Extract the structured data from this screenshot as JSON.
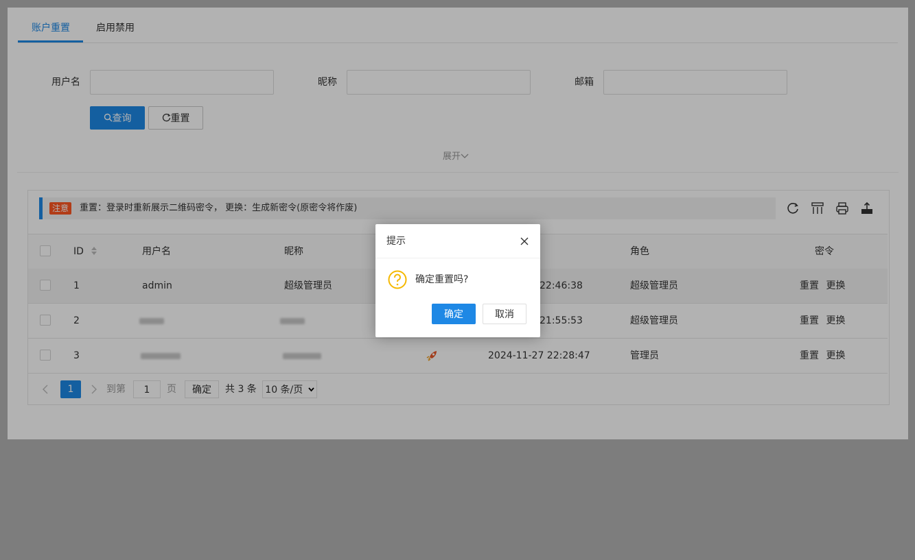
{
  "tabs": [
    {
      "label": "账户重置",
      "active": true
    },
    {
      "label": "启用禁用",
      "active": false
    }
  ],
  "search": {
    "username_label": "用户名",
    "nickname_label": "昵称",
    "email_label": "邮箱",
    "query_label": "查询",
    "reset_label": "重置",
    "expand_label": "展开"
  },
  "notice": {
    "badge": "注意",
    "text": "重置：登录时重新展示二维码密令， 更换：生成新密令(原密令将作废)"
  },
  "table": {
    "headers": {
      "id": "ID",
      "username": "用户名",
      "nickname": "昵称",
      "role": "角色",
      "token": "密令"
    },
    "rows": [
      {
        "id": "1",
        "username": "admin",
        "nickname": "超级管理员",
        "time": "22:46:38",
        "role": "超级管理员",
        "reset": "重置",
        "change": "更换"
      },
      {
        "id": "2",
        "username": "",
        "nickname": "",
        "time": "21:55:53",
        "role": "超级管理员",
        "reset": "重置",
        "change": "更换"
      },
      {
        "id": "3",
        "username": "",
        "nickname": "",
        "time": "2024-11-27 22:28:47",
        "role": "管理员",
        "reset": "重置",
        "change": "更换"
      }
    ]
  },
  "pager": {
    "current": "1",
    "goto_label": "到第",
    "page_input": "1",
    "page_unit": "页",
    "ok_label": "确定",
    "total": "共 3 条",
    "page_size": "10 条/页"
  },
  "dialog": {
    "title": "提示",
    "message": "确定重置吗?",
    "ok_label": "确定",
    "cancel_label": "取消"
  },
  "colors": {
    "primary": "#1e88e5",
    "badge": "#ff5722",
    "warning_icon": "#f5b800"
  }
}
